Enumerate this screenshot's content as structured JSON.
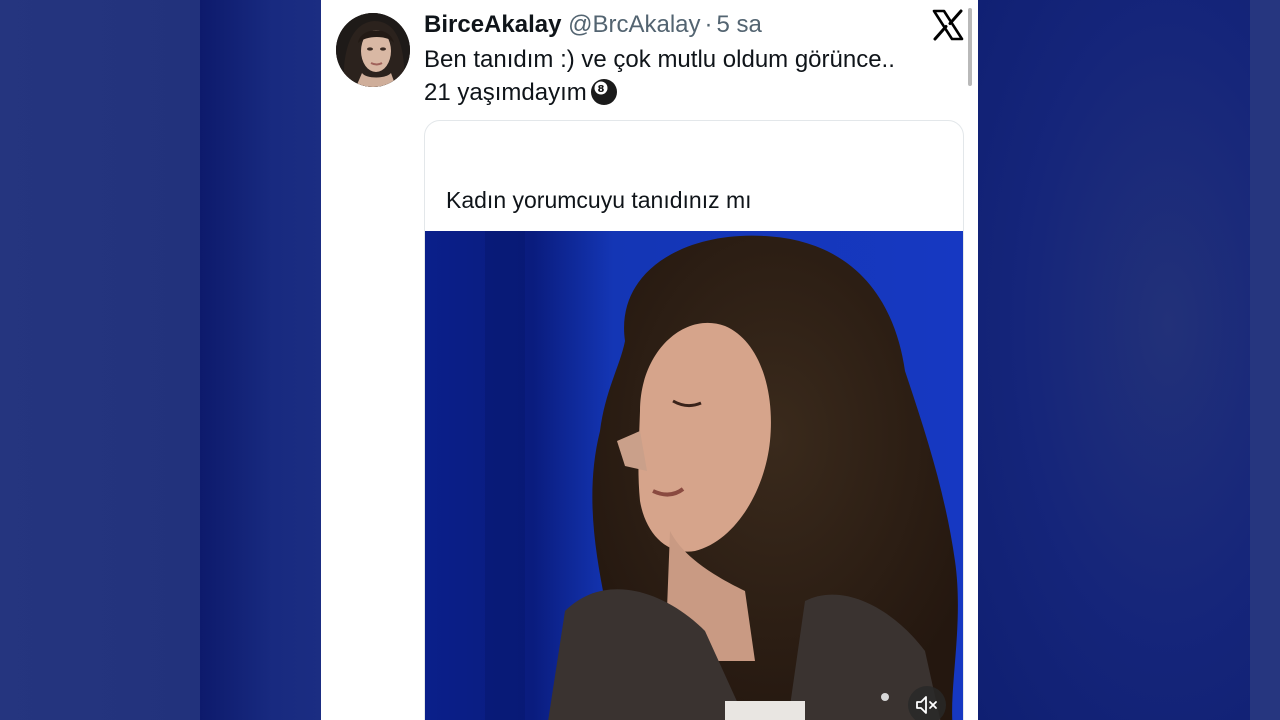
{
  "tweet": {
    "display_name": "BirceAkalay",
    "handle": "@BrcAkalay",
    "separator": "·",
    "time": "5 sa",
    "text_line1": "Ben tanıdım :) ve çok mutlu oldum görünce..",
    "text_line2": "21 yaşımdayım",
    "emoji": "8-ball-emoji"
  },
  "quoted_tweet": {
    "text": "Kadın yorumcuyu tanıdınız mı",
    "media": "video",
    "muted": true
  },
  "icons": [
    "x-logo-icon",
    "mute-icon"
  ],
  "colors": {
    "background": "#1f2f78",
    "card": "#ffffff",
    "primary_text": "#0f1419",
    "secondary_text": "#536471",
    "video_background": "#0f2ea3"
  }
}
